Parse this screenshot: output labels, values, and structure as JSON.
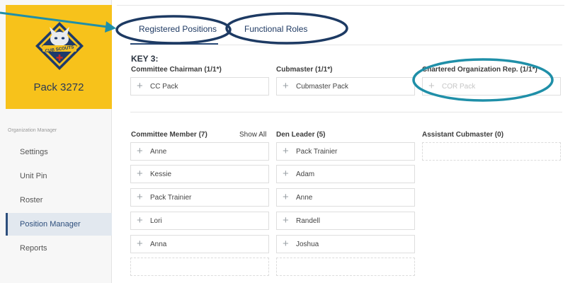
{
  "sidebar": {
    "pack_name": "Pack 3272",
    "logo_text": "CUB SCOUTS",
    "section_label": "Organization Manager",
    "items": [
      {
        "label": "Settings"
      },
      {
        "label": "Unit Pin"
      },
      {
        "label": "Roster"
      },
      {
        "label": "Position Manager",
        "active": true
      },
      {
        "label": "Reports"
      }
    ]
  },
  "tabs": [
    {
      "label": "Registered Positions",
      "selected": true
    },
    {
      "label": "Functional Roles",
      "selected": false
    }
  ],
  "key3": {
    "title": "KEY 3:",
    "committee_chairman": {
      "header": "Committee Chairman (1/1*)",
      "member": "CC Pack"
    },
    "cubmaster": {
      "header": "Cubmaster (1/1*)",
      "member": "Cubmaster Pack"
    },
    "chartered_org_rep": {
      "header": "Chartered Organization Rep. (1/1*)",
      "member": "COR Pack"
    }
  },
  "positions": {
    "committee_member": {
      "header": "Committee Member (7)",
      "show_all": "Show All",
      "members": [
        "Anne",
        "Kessie",
        "Pack Trainier",
        "Lori",
        "Anna"
      ]
    },
    "den_leader": {
      "header": "Den Leader (5)",
      "members": [
        "Pack Trainier",
        "Adam",
        "Anne",
        "Randell",
        "Joshua"
      ]
    },
    "assistant_cubmaster": {
      "header": "Assistant Cubmaster (0)",
      "members": []
    }
  },
  "icons": {
    "add": "plus-icon",
    "callout": "arrow-icon"
  },
  "colors": {
    "brand_yellow": "#f7c21b",
    "navy": "#2d4e7c",
    "highlight_teal": "#1f8fa8",
    "active_nav_bg": "#e2e8ef"
  }
}
